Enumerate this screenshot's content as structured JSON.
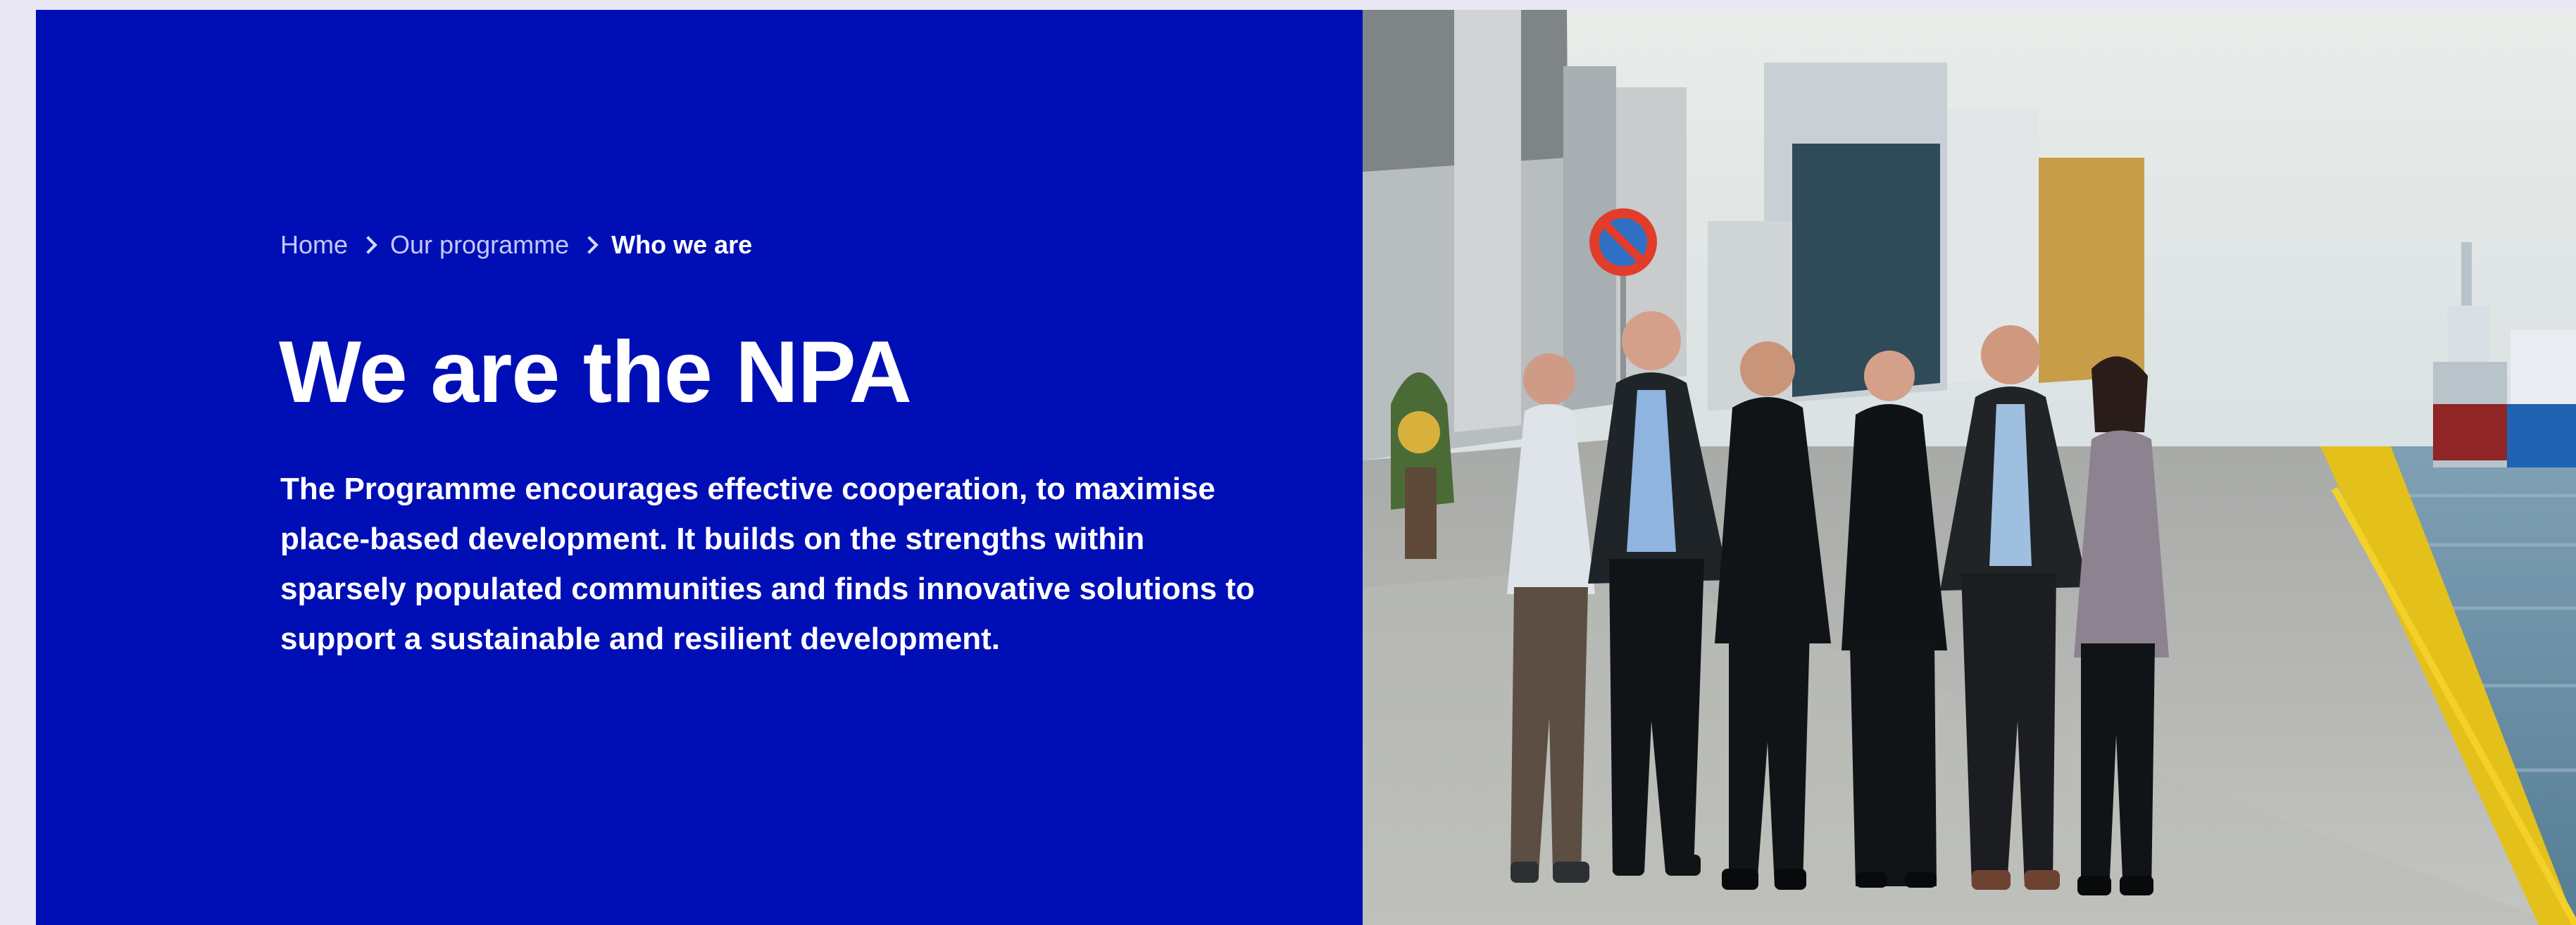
{
  "breadcrumb": {
    "items": [
      {
        "label": "Home"
      },
      {
        "label": "Our programme"
      }
    ],
    "current": "Who we are"
  },
  "hero": {
    "title": "We are the NPA",
    "description": "The Programme encourages effective cooperation, to maximise place-based development. It builds on the strengths within sparsely populated communities and finds innovative solutions to support a sustainable and resilient development."
  },
  "colors": {
    "hero_background": "#000fb5",
    "page_background": "#e8e7f3",
    "title_text": "#ffffff"
  }
}
